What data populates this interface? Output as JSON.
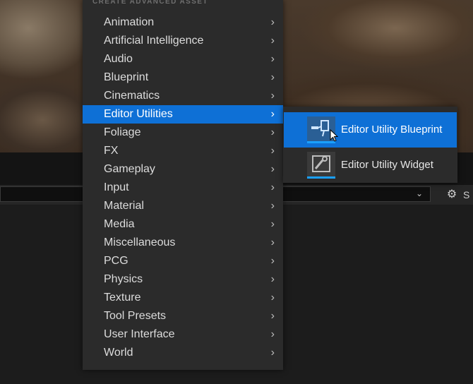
{
  "menu": {
    "header": "CREATE ADVANCED ASSET",
    "items": [
      {
        "label": "Animation"
      },
      {
        "label": "Artificial Intelligence"
      },
      {
        "label": "Audio"
      },
      {
        "label": "Blueprint"
      },
      {
        "label": "Cinematics"
      },
      {
        "label": "Editor Utilities"
      },
      {
        "label": "Foliage"
      },
      {
        "label": "FX"
      },
      {
        "label": "Gameplay"
      },
      {
        "label": "Input"
      },
      {
        "label": "Material"
      },
      {
        "label": "Media"
      },
      {
        "label": "Miscellaneous"
      },
      {
        "label": "PCG"
      },
      {
        "label": "Physics"
      },
      {
        "label": "Texture"
      },
      {
        "label": "Tool Presets"
      },
      {
        "label": "User Interface"
      },
      {
        "label": "World"
      }
    ],
    "active_label": "Editor Utilities"
  },
  "submenu": {
    "items": [
      {
        "label": "Editor Utility Blueprint",
        "icon": "editor-utility-blueprint-icon"
      },
      {
        "label": "Editor Utility Widget",
        "icon": "editor-utility-widget-icon"
      }
    ]
  },
  "toolbar": {
    "settings_label": "S"
  },
  "colors": {
    "accent": "#0e70d6",
    "menu_bg": "#2b2b2b",
    "underline": "#1aa0ff"
  }
}
